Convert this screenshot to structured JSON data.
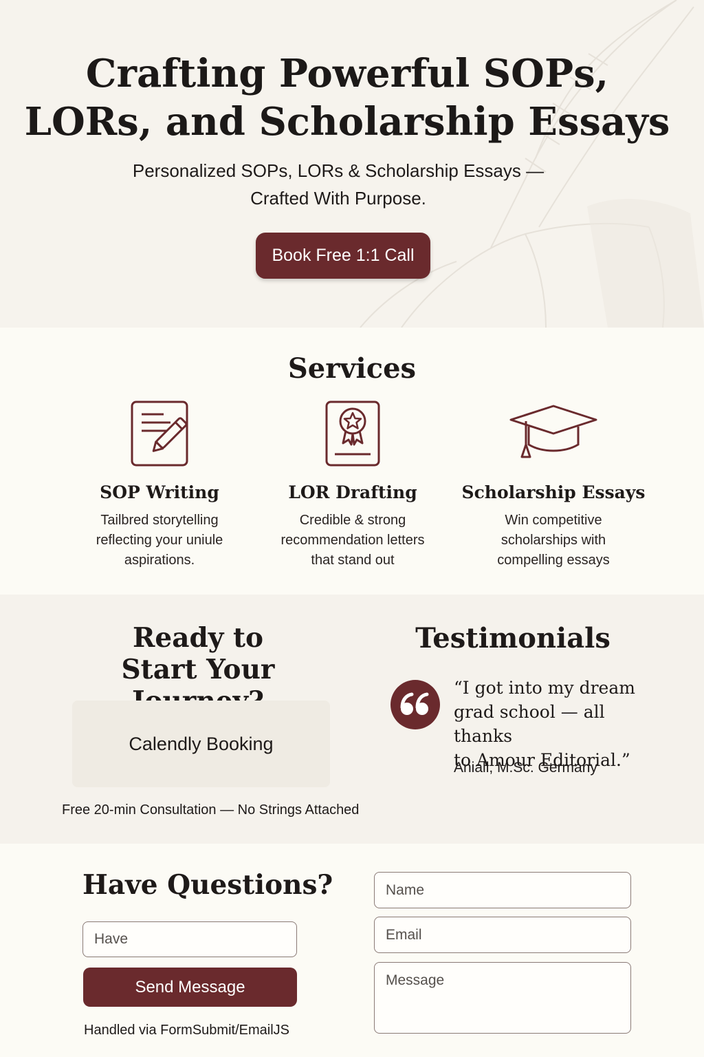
{
  "colors": {
    "accent": "#6a2a2d",
    "background": "#fbf9f3",
    "text": "#1e1a19"
  },
  "hero": {
    "title_line1": "Crafting Powerful SOPs,",
    "title_line2": "LORs, and Scholarship Essays",
    "subtitle_line1": "Personalized SOPs, LORs & Scholarship Essays —",
    "subtitle_line2": "Crafted With Purpose.",
    "cta_label": "Book Free 1:1 Call"
  },
  "services": {
    "title": "Services",
    "items": [
      {
        "icon": "document-pencil-icon",
        "title": "SOP Writing",
        "desc_lines": [
          "Tailbred storytelling",
          "reflecting your uniule",
          "aspirations."
        ]
      },
      {
        "icon": "certificate-award-icon",
        "title": "LOR Drafting",
        "desc_lines": [
          "Credible & strong",
          "recommendation letters",
          "that stand out"
        ]
      },
      {
        "icon": "graduation-cap-icon",
        "title": "Scholarship Essays",
        "desc_lines": [
          "Win competitive",
          "scholarships with",
          "compelling essays"
        ]
      }
    ]
  },
  "journey": {
    "title_line1": "Ready to",
    "title_line2": "Start Your Journey?",
    "calendly_label": "Calendly Booking",
    "note": "Free 20-min Consultation — No Strings Attached"
  },
  "testimonials": {
    "title": "Testimonials",
    "quote_icon": "quote-icon",
    "quote_lines": [
      "“I got into my dream",
      "grad school — all thanks",
      "to Amour Editorial.”"
    ],
    "author": "Aniall, M.Sc. Germany"
  },
  "contact": {
    "title": "Have Questions?",
    "have_placeholder": "Have",
    "send_label": "Send Message",
    "handled_note": "Handled via FormSubmit/EmailJS",
    "name_placeholder": "Name",
    "email_placeholder": "Email",
    "message_placeholder": "Message"
  }
}
